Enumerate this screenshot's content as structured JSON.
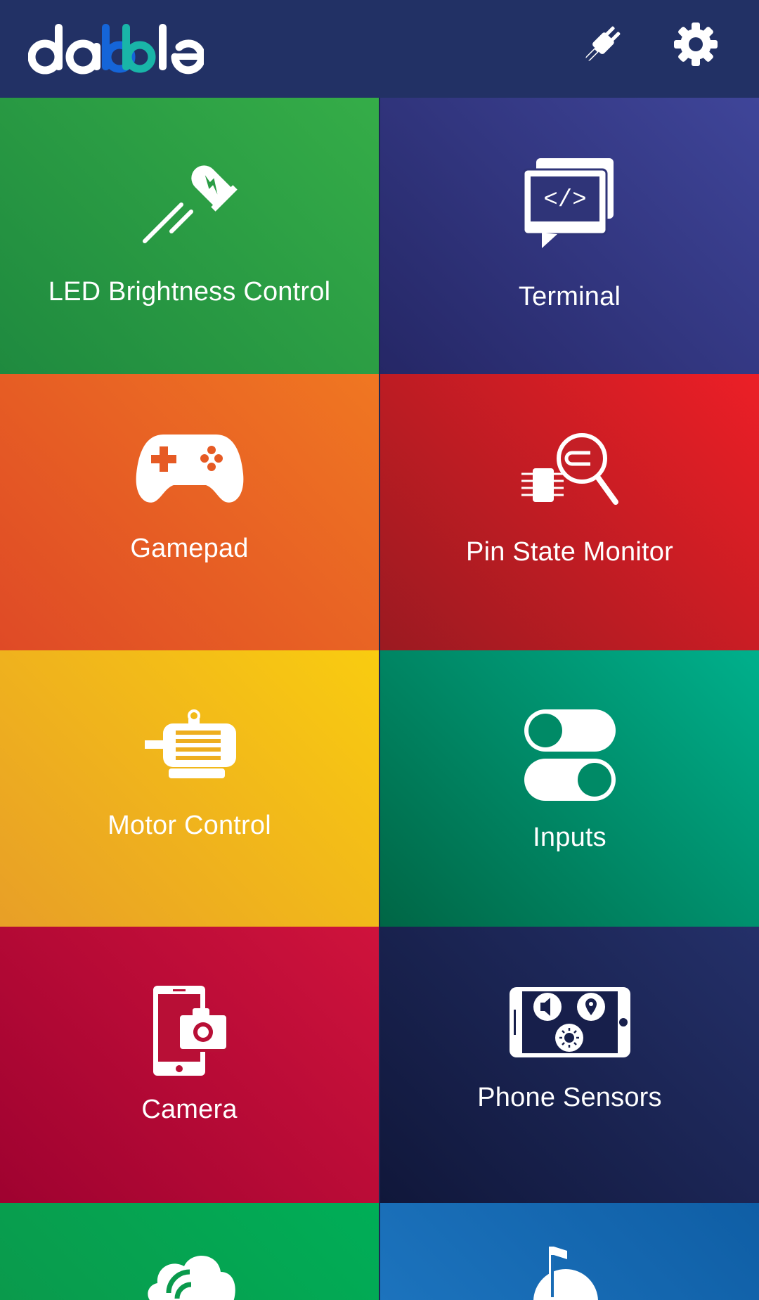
{
  "app": {
    "logo_text": "dabble",
    "colors": {
      "topbar": "#223165",
      "logo_accent_blue": "#1565d8",
      "logo_accent_teal": "#19b5a8"
    }
  },
  "toolbar": {
    "connect_icon": "plug-icon",
    "settings_icon": "gear-icon"
  },
  "tiles": [
    {
      "label": "LED Brightness Control",
      "icon": "led-icon",
      "colors": [
        "#1f8a3f",
        "#35ad48"
      ]
    },
    {
      "label": "Terminal",
      "icon": "terminal-icon",
      "colors": [
        "#252766",
        "#3f4599"
      ]
    },
    {
      "label": "Gamepad",
      "icon": "gamepad-icon",
      "colors": [
        "#df4a26",
        "#f07722"
      ]
    },
    {
      "label": "Pin State Monitor",
      "icon": "pin-monitor-icon",
      "colors": [
        "#9b1a21",
        "#ec1f26"
      ]
    },
    {
      "label": "Motor Control",
      "icon": "motor-icon",
      "colors": [
        "#e89f27",
        "#f9cc10"
      ]
    },
    {
      "label": "Inputs",
      "icon": "toggle-switches-icon",
      "colors": [
        "#006645",
        "#00b08c"
      ]
    },
    {
      "label": "Camera",
      "icon": "camera-phone-icon",
      "colors": [
        "#9f0230",
        "#cf133c"
      ]
    },
    {
      "label": "Phone Sensors",
      "icon": "phone-sensors-icon",
      "colors": [
        "#10173a",
        "#243069"
      ]
    },
    {
      "label": "",
      "icon": "cloud-signal-icon",
      "colors": [
        "#0a9a4c",
        "#00ae57"
      ]
    },
    {
      "label": "",
      "icon": "music-icon",
      "colors": [
        "#1c73bd",
        "#0f5ea5"
      ]
    }
  ]
}
